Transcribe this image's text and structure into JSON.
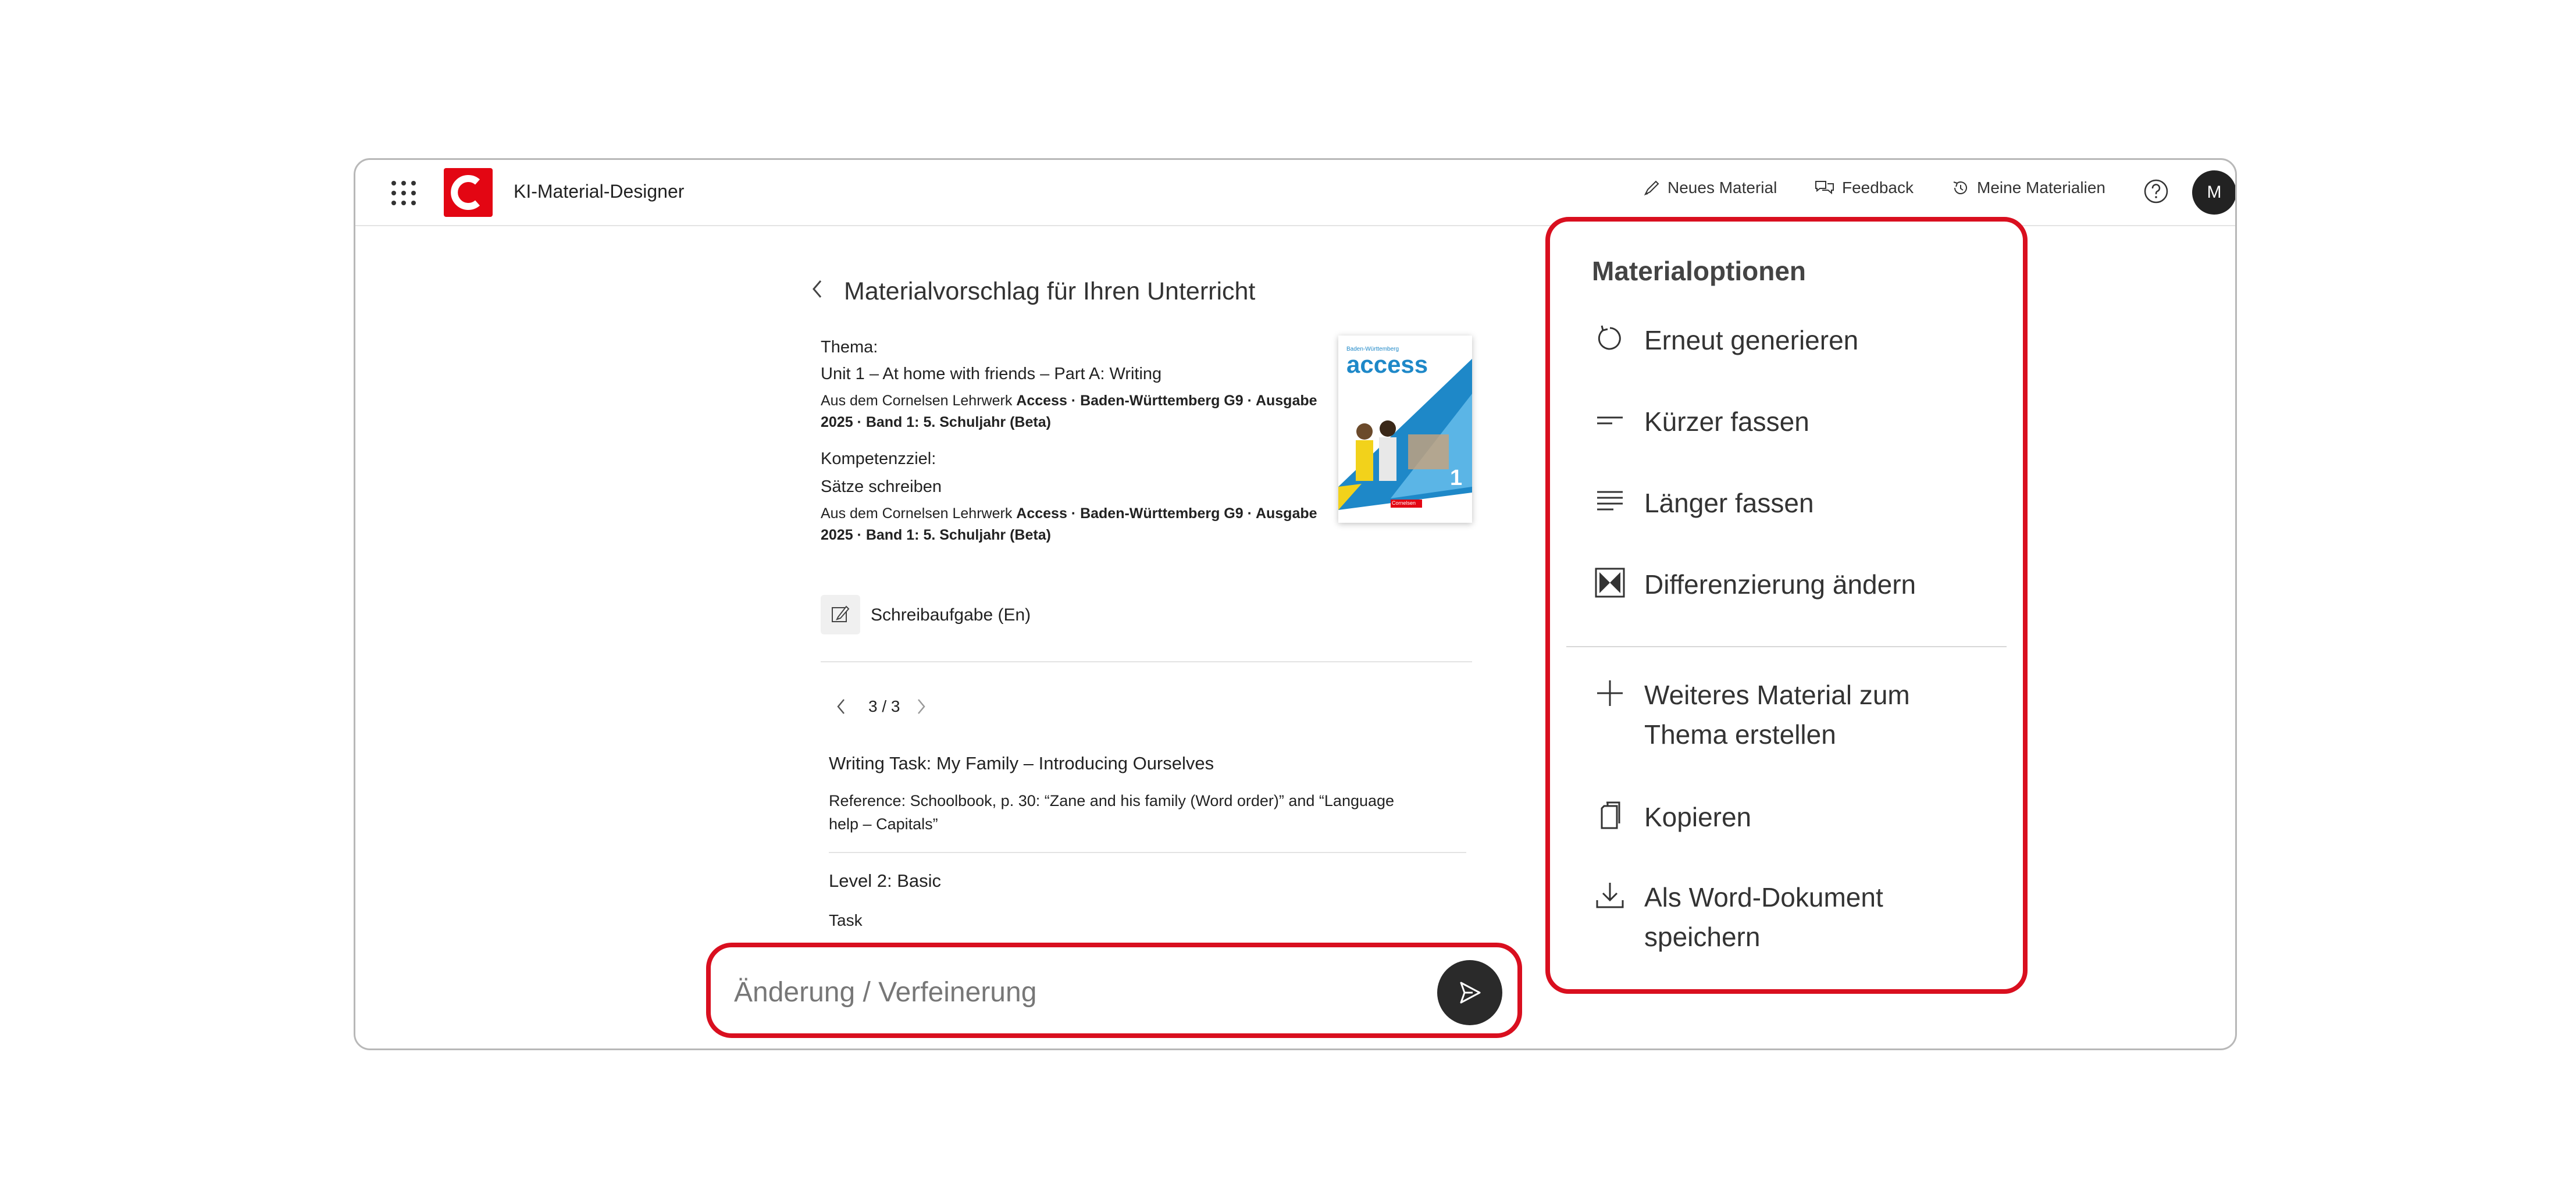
{
  "header": {
    "app_title": "KI-Material-Designer",
    "logo_letter": "C",
    "nav": {
      "new_material": "Neues Material",
      "feedback": "Feedback",
      "my_materials": "Meine Materialien"
    },
    "avatar_initial": "M"
  },
  "main": {
    "page_title": "Materialvorschlag für Ihren Unterricht",
    "theme_label": "Thema:",
    "theme_value": "Unit 1 – At home with friends – Part A: Writing",
    "source_prefix": "Aus dem Cornelsen Lehrwerk ",
    "source_bold_1": "Access · Baden-Württemberg G9 · Ausgabe",
    "source_bold_2": "2025 · Band 1: 5. Schuljahr (Beta)",
    "competence_label": "Kompetenzziel:",
    "competence_value": "Sätze schreiben",
    "book": {
      "brand": "access",
      "number": "1",
      "publisher": "Cornelsen",
      "small_text": "Baden-Württemberg"
    },
    "task_type": "Schreibaufgabe (En)",
    "pager": "3 / 3",
    "content": {
      "heading": "Writing Task: My Family – Introducing Ourselves",
      "reference_prefix": "Reference: ",
      "reference_bold_1": "Schoolbook, p. 30: “Zane and his family (Word order)” and “Language",
      "reference_bold_2": "help – Capitals”",
      "level": "Level 2: Basic",
      "task": "Task"
    }
  },
  "input": {
    "placeholder": "Änderung / Verfeinerung"
  },
  "options": {
    "title": "Materialoptionen",
    "items": [
      {
        "icon": "refresh-icon",
        "label": "Erneut generieren"
      },
      {
        "icon": "short-lines-icon",
        "label": "Kürzer fassen"
      },
      {
        "icon": "long-lines-icon",
        "label": "Länger fassen"
      },
      {
        "icon": "differentiation-icon",
        "label": "Differenzierung ändern"
      },
      {
        "icon": "plus-icon",
        "label_1": "Weiteres Material zum",
        "label_2": "Thema erstellen"
      },
      {
        "icon": "copy-icon",
        "label": "Kopieren"
      },
      {
        "icon": "download-icon",
        "label_1": "Als Word-Dokument",
        "label_2": "speichern"
      }
    ]
  },
  "colors": {
    "accent_red": "#d90f1f",
    "logo_red": "#e30613",
    "dark": "#2a2a2a",
    "book_blue": "#1e88c8"
  }
}
